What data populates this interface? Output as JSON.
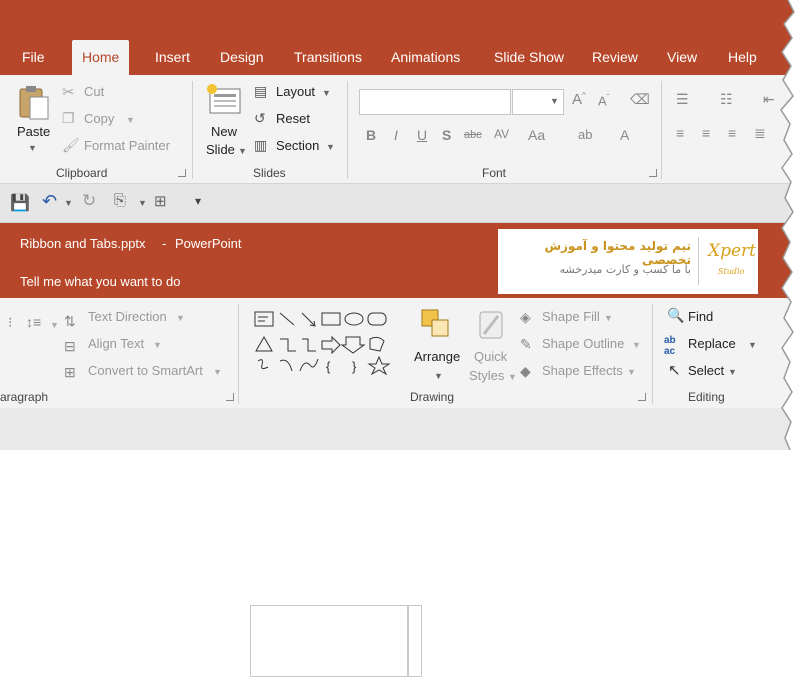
{
  "tabs": [
    "File",
    "Home",
    "Insert",
    "Design",
    "Transitions",
    "Animations",
    "Slide Show",
    "Review",
    "View",
    "Help"
  ],
  "clipboard": {
    "paste": "Paste",
    "cut": "Cut",
    "copy": "Copy",
    "format_painter": "Format Painter",
    "group": "Clipboard"
  },
  "slides": {
    "new_slide_1": "New",
    "new_slide_2": "Slide",
    "layout": "Layout",
    "reset": "Reset",
    "section": "Section",
    "group": "Slides"
  },
  "font": {
    "group": "Font",
    "font_value": "",
    "size_value": ""
  },
  "title": {
    "file": "Ribbon and Tabs.pptx",
    "sep": "-",
    "app": "PowerPoint",
    "tell_me": "Tell me what you want to do"
  },
  "banner": {
    "line1": "تیم تولید محتوا و آموزش تخصصی",
    "line2": "با ما کسب و کارت میدرخشه",
    "logo": "Xpert",
    "logo_sub": "Studio"
  },
  "paragraph": {
    "text_direction": "Text Direction",
    "align_text": "Align Text",
    "convert": "Convert to SmartArt",
    "group": "aragraph"
  },
  "drawing": {
    "arrange": "Arrange",
    "quick_1": "Quick",
    "quick_2": "Styles",
    "shape_fill": "Shape Fill",
    "shape_outline": "Shape Outline",
    "shape_effects": "Shape Effects",
    "group": "Drawing"
  },
  "editing": {
    "find": "Find",
    "replace": "Replace",
    "select": "Select",
    "group": "Editing"
  },
  "colors": {
    "accent": "#b7472a",
    "ribbon": "#f3f3f3"
  }
}
